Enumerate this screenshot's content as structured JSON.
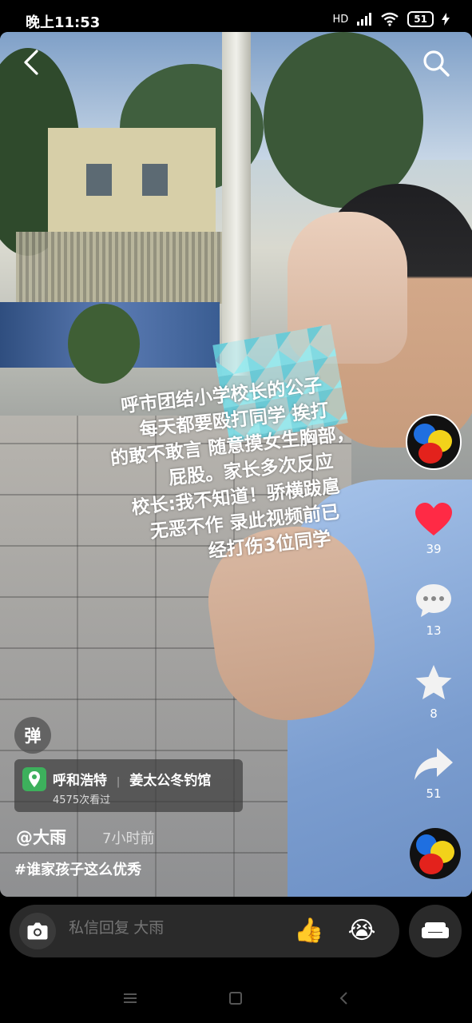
{
  "status_bar": {
    "time": "晚上11:53",
    "network": "HD",
    "battery": "51"
  },
  "caption": {
    "lines": [
      "呼市团结小学校长的公子",
      "每天都要殴打同学 挨打",
      "的敢不敢言 随意摸女生胸部，",
      "屁股。家长多次反应",
      "校长:我不知道！骄横跋扈",
      "无恶不作 录此视频前已",
      "经打伤3位同学"
    ]
  },
  "sidebar": {
    "likes": "39",
    "comments": "13",
    "favorites": "8",
    "shares": "51"
  },
  "danmu": {
    "label": "弹"
  },
  "location": {
    "city": "呼和浩特",
    "place": "姜太公冬钓馆",
    "views": "4575次看过"
  },
  "author": {
    "name": "@大雨",
    "time_ago": "7小时前"
  },
  "hashtag": "#谁家孩子这么优秀",
  "reply_bar": {
    "placeholder": "私信回复 大雨",
    "emoji_1": "👍",
    "emoji_2": "😭"
  },
  "icons": [
    "back-arrow-icon",
    "search-icon",
    "heart-icon",
    "comment-icon",
    "star-icon",
    "share-icon",
    "location-pin-icon",
    "camera-icon",
    "sofa-icon"
  ],
  "colors": {
    "heart": "#ff2a45",
    "location_pin": "#3db05c",
    "reply_bar": "#2a2a2a"
  }
}
